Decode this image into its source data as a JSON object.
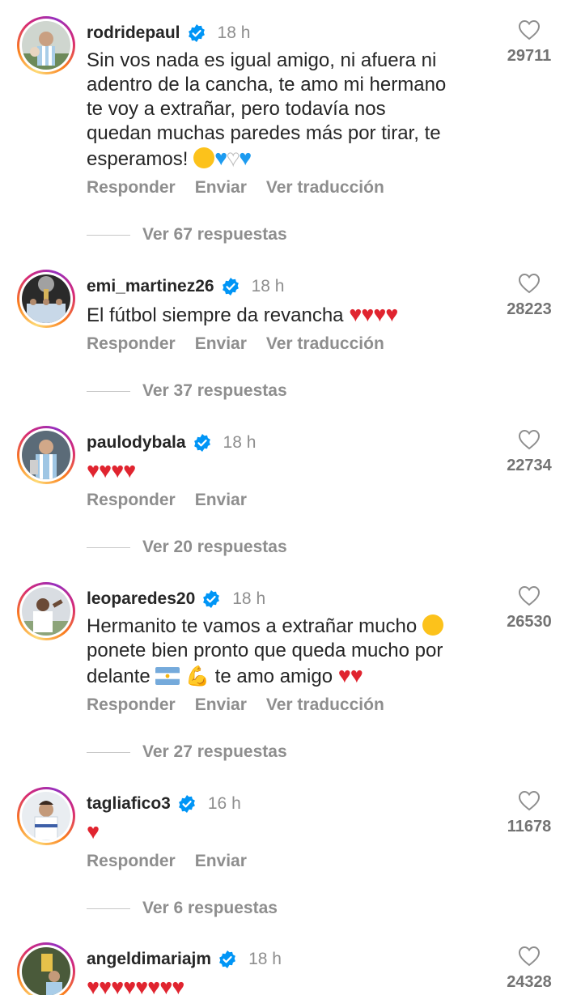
{
  "comments": [
    {
      "username": "rodridepaul",
      "time": "18 h",
      "text_lines": [
        "Sin vos nada es igual amigo, ni afuera ni",
        "adentro de la cancha, te amo mi hermano",
        "te voy a extrañar, pero todavía nos",
        "quedan muchas paredes más por tirar, te",
        "esperamos!"
      ],
      "likes": "29711",
      "actions": [
        "Responder",
        "Enviar",
        "Ver traducción"
      ],
      "replies": "Ver 67 respuestas"
    },
    {
      "username": "emi_martinez26",
      "time": "18 h",
      "text": "El fútbol siempre da revancha",
      "likes": "28223",
      "actions": [
        "Responder",
        "Enviar",
        "Ver traducción"
      ],
      "replies": "Ver 37 respuestas"
    },
    {
      "username": "paulodybala",
      "time": "18 h",
      "likes": "22734",
      "actions": [
        "Responder",
        "Enviar"
      ],
      "replies": "Ver 20 respuestas"
    },
    {
      "username": "leoparedes20",
      "time": "18 h",
      "text_lines": [
        "Hermanito te vamos a extrañar mucho",
        "ponete bien pronto que queda mucho por",
        "delante",
        "te amo amigo"
      ],
      "likes": "26530",
      "actions": [
        "Responder",
        "Enviar",
        "Ver traducción"
      ],
      "replies": "Ver 27 respuestas"
    },
    {
      "username": "tagliafico3",
      "time": "16 h",
      "likes": "11678",
      "actions": [
        "Responder",
        "Enviar"
      ],
      "replies": "Ver 6 respuestas"
    },
    {
      "username": "angeldimariajm",
      "time": "18 h",
      "likes": "24328"
    }
  ],
  "icons": {
    "verified": "verified-badge-icon",
    "like": "heart-outline-icon"
  },
  "colors": {
    "verified": "#0095f6",
    "heart": "#e0242f",
    "muted": "#8e8e8e"
  }
}
